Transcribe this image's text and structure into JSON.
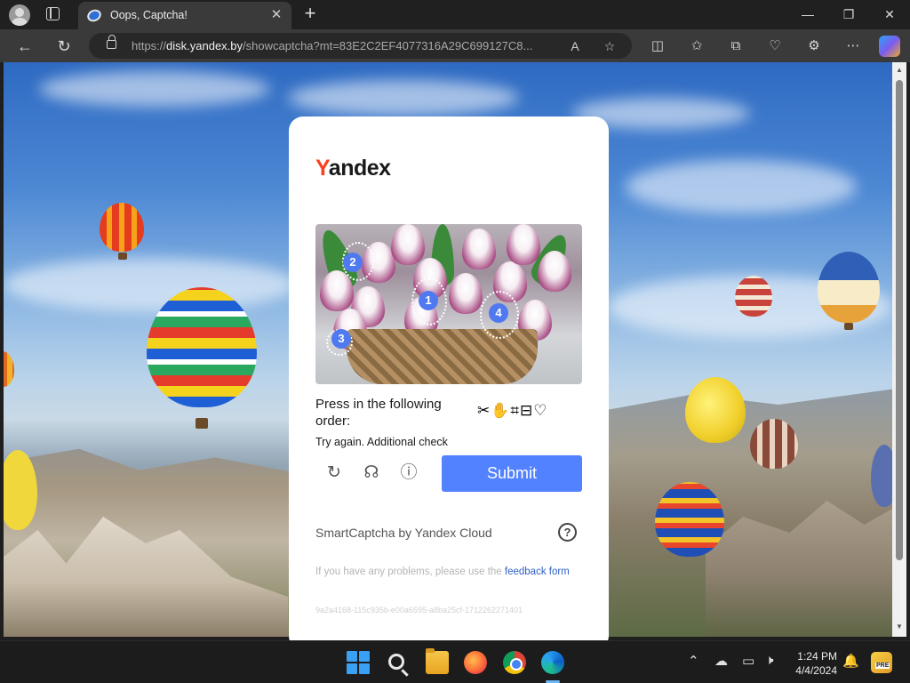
{
  "browser": {
    "tab_title": "Oops, Captcha!",
    "url_scheme": "https://",
    "url_host": "disk.yandex.by",
    "url_path": "/showcaptcha?mt=83E2C2EF4077316A29C699127C8...",
    "win_min": "—",
    "win_max": "❐",
    "win_close": "✕"
  },
  "captcha": {
    "logo_first": "Y",
    "logo_rest": "andex",
    "instruction": "Press in the following order:",
    "order_icons": "✂✋⌗⊟♡",
    "error": "Try again. Additional check",
    "submit_label": "Submit",
    "brand": "SmartCaptcha by Yandex Cloud",
    "problems_text": "If you have any problems, please use the ",
    "feedback_link": "feedback form",
    "request_id": "9a2a4168-115c935b-e00a6595-a8ba25cf-1712262271401",
    "markers": [
      "1",
      "2",
      "3",
      "4"
    ]
  },
  "taskbar": {
    "time": "1:24 PM",
    "date": "4/4/2024"
  },
  "colors": {
    "yandex_red": "#fc3f1d",
    "submit_blue": "#5282ff",
    "marker_blue": "#4f79f0"
  }
}
